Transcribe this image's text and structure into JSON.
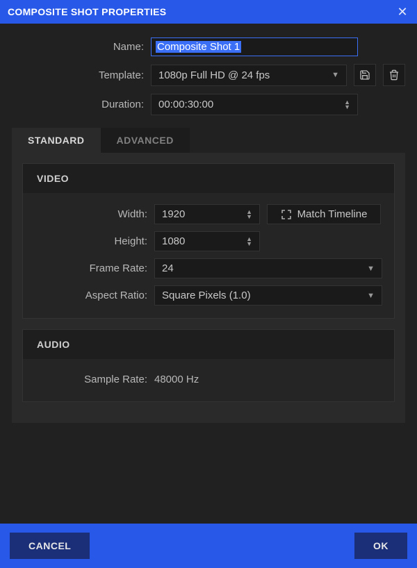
{
  "title": "COMPOSITE SHOT PROPERTIES",
  "form": {
    "name_label": "Name:",
    "name_value": "Composite Shot 1",
    "template_label": "Template:",
    "template_value": "1080p Full HD @ 24 fps",
    "duration_label": "Duration:",
    "duration_value": "00:00:30:00"
  },
  "tabs": {
    "standard": "STANDARD",
    "advanced": "ADVANCED"
  },
  "video": {
    "header": "VIDEO",
    "width_label": "Width:",
    "width_value": "1920",
    "height_label": "Height:",
    "height_value": "1080",
    "framerate_label": "Frame Rate:",
    "framerate_value": "24",
    "aspect_label": "Aspect Ratio:",
    "aspect_value": "Square Pixels (1.0)",
    "match_timeline": "Match Timeline"
  },
  "audio": {
    "header": "AUDIO",
    "samplerate_label": "Sample Rate:",
    "samplerate_value": "48000 Hz"
  },
  "footer": {
    "cancel": "CANCEL",
    "ok": "OK"
  }
}
